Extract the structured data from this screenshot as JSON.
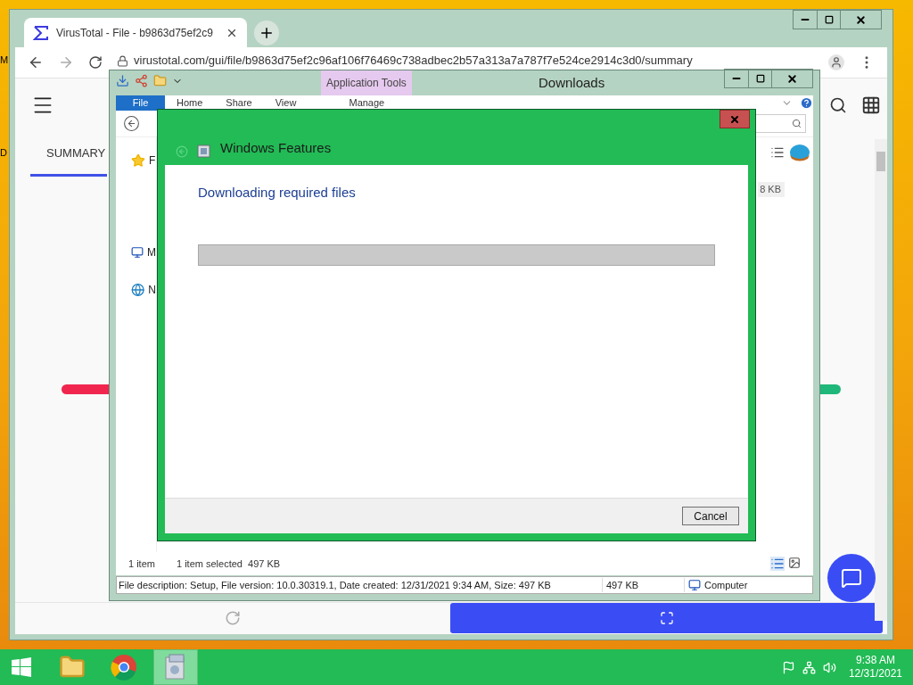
{
  "desktop": {
    "labels": [
      "M",
      "D"
    ]
  },
  "browser": {
    "tab_title": "VirusTotal - File - b9863d75ef2c9",
    "url": "virustotal.com/gui/file/b9863d75ef2c96af106f76469c738adbec2b57a313a7a787f7e524ce2914c3d0/summary",
    "nav_tab": "SUMMARY"
  },
  "explorer": {
    "title": "Downloads",
    "context_tab": "Application Tools",
    "ribbon_tabs": [
      {
        "label": "File",
        "selected": true
      },
      {
        "label": "Home",
        "selected": false
      },
      {
        "label": "Share",
        "selected": false
      },
      {
        "label": "View",
        "selected": false
      },
      {
        "label": "Manage",
        "selected": false
      }
    ],
    "nav_items": [
      {
        "kind": "star",
        "label": "F"
      },
      {
        "kind": "monitor",
        "label": "M"
      },
      {
        "kind": "network",
        "label": "N"
      }
    ],
    "size_cell": "8 KB",
    "status": {
      "count": "1 item",
      "selected": "1 item selected",
      "size": "497 KB"
    },
    "details": {
      "description": "File description: Setup, File version: 10.0.30319.1, Date created: 12/31/2021 9:34 AM, Size: 497 KB",
      "size": "497 KB",
      "location": "Computer"
    }
  },
  "dialog": {
    "title": "Windows Features",
    "message": "Downloading required files",
    "level": 0,
    "cancel": "Cancel"
  },
  "taskbar": {
    "apps": [
      {
        "kind": "explorer",
        "selected": false
      },
      {
        "kind": "chrome",
        "selected": false
      },
      {
        "kind": "features",
        "selected": true
      }
    ],
    "time": "9:38 AM",
    "date": "12/31/2021"
  }
}
